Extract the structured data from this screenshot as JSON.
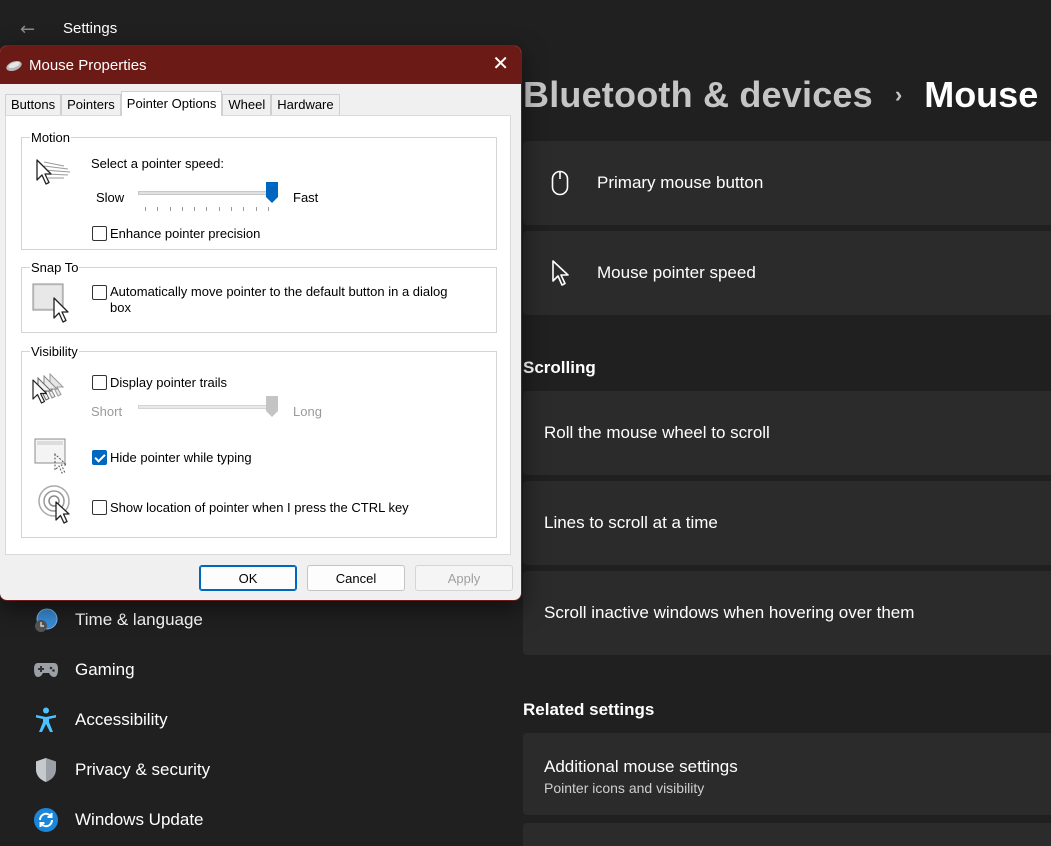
{
  "app": {
    "title": "Settings"
  },
  "breadcrumb": {
    "parent": "Bluetooth & devices",
    "separator": "›",
    "current": "Mouse"
  },
  "cards": {
    "primary_button": "Primary mouse button",
    "pointer_speed": "Mouse pointer speed",
    "roll_wheel": "Roll the mouse wheel to scroll",
    "lines_scroll": "Lines to scroll at a time",
    "scroll_inactive": "Scroll inactive windows when hovering over them",
    "additional_title": "Additional mouse settings",
    "additional_sub": "Pointer icons and visibility"
  },
  "sections": {
    "scrolling": "Scrolling",
    "related": "Related settings"
  },
  "nav": [
    {
      "label": "Time & language",
      "icon": "globe-clock-icon"
    },
    {
      "label": "Gaming",
      "icon": "gamepad-icon"
    },
    {
      "label": "Accessibility",
      "icon": "accessibility-icon"
    },
    {
      "label": "Privacy & security",
      "icon": "shield-icon"
    },
    {
      "label": "Windows Update",
      "icon": "update-icon"
    }
  ],
  "dialog": {
    "title": "Mouse Properties",
    "tabs": [
      "Buttons",
      "Pointers",
      "Pointer Options",
      "Wheel",
      "Hardware"
    ],
    "active_tab": "Pointer Options",
    "motion": {
      "group": "Motion",
      "label": "Select a pointer speed:",
      "slow": "Slow",
      "fast": "Fast",
      "speed_fraction": 1.0,
      "enhance_label": "Enhance pointer precision",
      "enhance_checked": false
    },
    "snap": {
      "group": "Snap To",
      "label_line1": "Automatically move pointer to the default button in a dialog",
      "label_line2": "box",
      "checked": false
    },
    "visibility": {
      "group": "Visibility",
      "trails_label": "Display pointer trails",
      "trails_checked": false,
      "short": "Short",
      "long": "Long",
      "trails_fraction": 1.0,
      "hide_label": "Hide pointer while typing",
      "hide_checked": true,
      "ctrl_label": "Show location of pointer when I press the CTRL key",
      "ctrl_checked": false
    },
    "buttons": {
      "ok": "OK",
      "cancel": "Cancel",
      "apply": "Apply"
    }
  },
  "colors": {
    "accent": "#0067c0",
    "titlebar": "#6b1a16",
    "background": "#202020",
    "card": "#2b2b2b"
  }
}
